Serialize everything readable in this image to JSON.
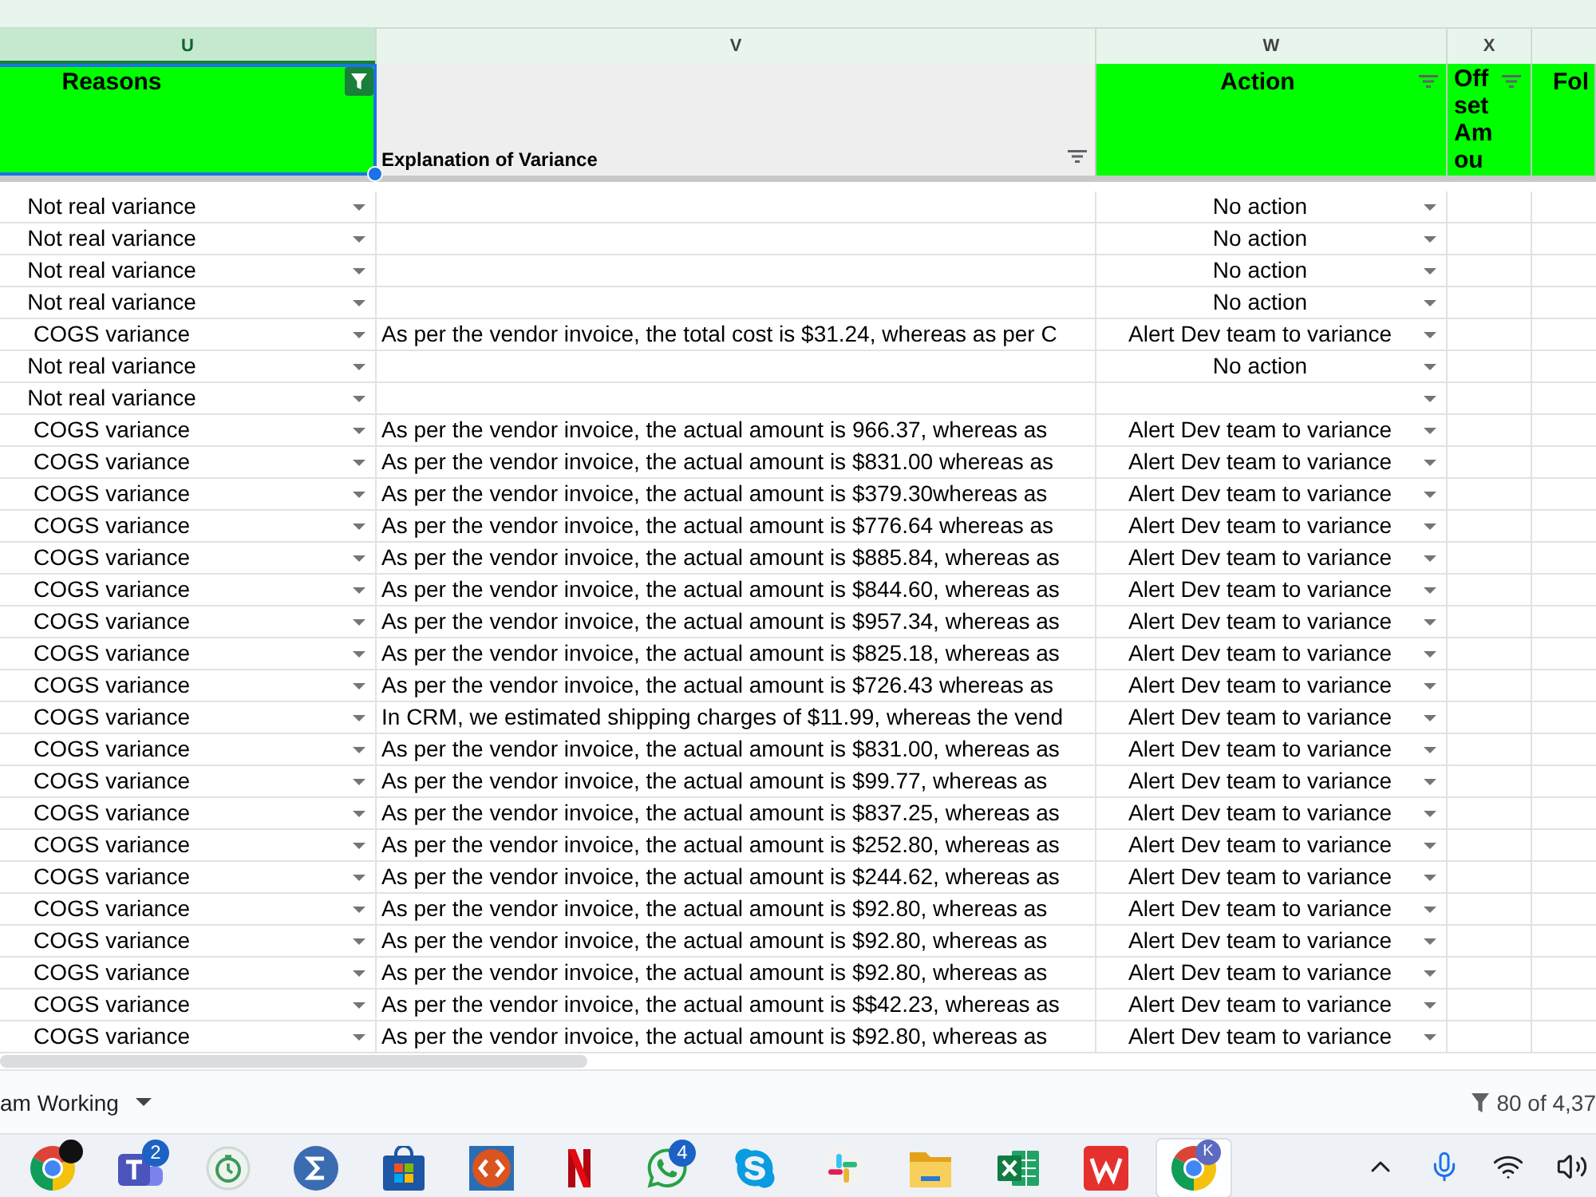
{
  "column_letters": [
    {
      "label": "U",
      "selected": true
    },
    {
      "label": "V",
      "selected": false
    },
    {
      "label": "W",
      "selected": false
    },
    {
      "label": "X",
      "selected": false
    }
  ],
  "headings": [
    {
      "text": "Reasons",
      "highlighted": true,
      "selected": true,
      "filter_button": true,
      "filter_active": true
    },
    {
      "text": "Explanation of Variance",
      "highlighted": false,
      "selected": false,
      "filter_button": true,
      "filter_active": false
    },
    {
      "text": "Action",
      "highlighted": true,
      "selected": false,
      "filter_button": true,
      "filter_active": false
    },
    {
      "text": "Off set Am ou",
      "highlighted": true,
      "selected": false,
      "filter_button": true,
      "filter_active": false
    },
    {
      "text": "Fol",
      "highlighted": true,
      "selected": false,
      "filter_button": false
    }
  ],
  "rows": [
    {
      "reason": "Not real variance",
      "action": "No action"
    },
    {
      "reason": "Not real variance",
      "action": "No action"
    },
    {
      "reason": "Not real variance",
      "action": "No action"
    },
    {
      "reason": "Not real variance",
      "action": "No action"
    },
    {
      "reason": "COGS variance",
      "explanation": "As per the vendor invoice, the total cost is $31.24, whereas as per C",
      "action": "Alert Dev team to variance"
    },
    {
      "reason": "Not real variance",
      "action": "No action"
    },
    {
      "reason": "Not real variance"
    },
    {
      "reason": "COGS variance",
      "explanation": "As per the vendor invoice, the actual amount is 966.37, whereas as",
      "action": "Alert Dev team to variance"
    },
    {
      "reason": "COGS variance",
      "explanation": "As per the vendor invoice, the actual amount is $831.00 whereas as",
      "action": "Alert Dev team to variance"
    },
    {
      "reason": "COGS variance",
      "explanation": "As per the vendor invoice, the actual amount is $379.30whereas as",
      "action": "Alert Dev team to variance"
    },
    {
      "reason": "COGS variance",
      "explanation": "As per the vendor invoice, the actual amount is $776.64 whereas as",
      "action": "Alert Dev team to variance"
    },
    {
      "reason": "COGS variance",
      "explanation": "As per the vendor invoice, the actual amount is $885.84, whereas as",
      "action": "Alert Dev team to variance"
    },
    {
      "reason": "COGS variance",
      "explanation": "As per the vendor invoice, the actual amount is $844.60, whereas as",
      "action": "Alert Dev team to variance"
    },
    {
      "reason": "COGS variance",
      "explanation": "As per the vendor invoice, the actual amount is $957.34, whereas as",
      "action": "Alert Dev team to variance"
    },
    {
      "reason": "COGS variance",
      "explanation": "As per the vendor invoice, the actual amount is $825.18, whereas as",
      "action": "Alert Dev team to variance"
    },
    {
      "reason": "COGS variance",
      "explanation": "As per the vendor invoice, the actual amount is $726.43 whereas as",
      "action": "Alert Dev team to variance"
    },
    {
      "reason": "COGS variance",
      "explanation": "In CRM, we estimated shipping charges of $11.99, whereas the vend",
      "action": "Alert Dev team to variance"
    },
    {
      "reason": "COGS variance",
      "explanation": "As per the vendor invoice, the actual amount is $831.00, whereas as",
      "action": "Alert Dev team to variance"
    },
    {
      "reason": "COGS variance",
      "explanation": "As per the vendor invoice, the actual amount is $99.77, whereas as",
      "action": "Alert Dev team to variance"
    },
    {
      "reason": "COGS variance",
      "explanation": "As per the vendor invoice, the actual amount is $837.25, whereas as",
      "action": "Alert Dev team to variance"
    },
    {
      "reason": "COGS variance",
      "explanation": "As per the vendor invoice, the actual amount is $252.80, whereas as",
      "action": "Alert Dev team to variance"
    },
    {
      "reason": "COGS variance",
      "explanation": "As per the vendor invoice, the actual amount is $244.62, whereas as",
      "action": "Alert Dev team to variance"
    },
    {
      "reason": "COGS variance",
      "explanation": "As per the vendor invoice, the actual amount is $92.80, whereas as",
      "action": "Alert Dev team to variance"
    },
    {
      "reason": "COGS variance",
      "explanation": "As per the vendor invoice, the actual amount is $92.80, whereas as",
      "action": "Alert Dev team to variance"
    },
    {
      "reason": "COGS variance",
      "explanation": "As per the vendor invoice, the actual amount is $92.80, whereas as",
      "action": "Alert Dev team to variance"
    },
    {
      "reason": "COGS variance",
      "explanation": "As per the vendor invoice, the actual amount is $$42.23, whereas as",
      "action": "Alert Dev team to variance"
    },
    {
      "reason": "COGS variance",
      "explanation": "As per the vendor invoice, the actual amount is $92.80, whereas as",
      "action": "Alert Dev team to variance"
    }
  ],
  "sheet_tab": {
    "label": "am Working"
  },
  "filter_count": "80 of 4,37",
  "taskbar": {
    "apps": [
      {
        "kind": "browser",
        "selected": false,
        "avatar": {
          "kind": "photo"
        }
      },
      {
        "kind": "people",
        "selected": false,
        "badge": "2"
      },
      {
        "kind": "timer",
        "selected": false
      },
      {
        "kind": "sigma",
        "selected": false
      },
      {
        "kind": "store",
        "selected": false
      },
      {
        "kind": "remote",
        "selected": false
      },
      {
        "kind": "letter_n",
        "selected": false
      },
      {
        "kind": "chat",
        "selected": false,
        "badge": "4"
      },
      {
        "kind": "letter_s",
        "selected": false
      },
      {
        "kind": "pinwheel",
        "selected": false
      },
      {
        "kind": "folder",
        "selected": false
      },
      {
        "kind": "spreadsheet",
        "selected": false
      },
      {
        "kind": "letter_w",
        "selected": false
      },
      {
        "kind": "browser",
        "selected": true,
        "avatar": {
          "kind": "letter",
          "text": "K"
        }
      }
    ],
    "tray": [
      {
        "kind": "chevron"
      },
      {
        "kind": "microphone"
      },
      {
        "kind": "wifi"
      },
      {
        "kind": "speaker"
      }
    ]
  }
}
